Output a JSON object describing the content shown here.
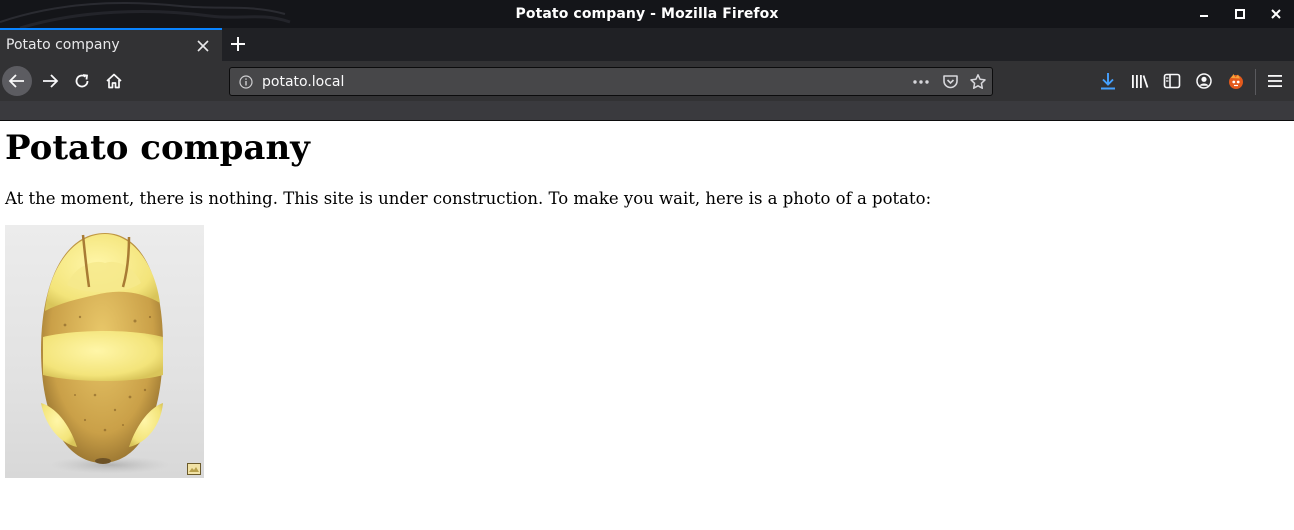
{
  "window": {
    "title": "Potato company - Mozilla Firefox"
  },
  "tabs": [
    {
      "label": "Potato company",
      "active": true
    }
  ],
  "navbar": {
    "url": "potato.local"
  },
  "page": {
    "heading": "Potato company",
    "text": "At the moment, there is nothing. This site is under construction. To make you wait, here is a photo of a potato:"
  },
  "icons": {
    "window_controls": [
      "minimize-icon",
      "maximize-icon",
      "close-icon"
    ],
    "navigation": [
      "back-arrow-icon",
      "forward-arrow-icon",
      "reload-icon",
      "home-icon"
    ],
    "urlbar": [
      "info-icon",
      "page-actions-dots-icon",
      "pocket-icon",
      "bookmark-star-icon"
    ],
    "toolbar": [
      "download-icon",
      "library-icon",
      "sidebar-icon",
      "account-icon",
      "extension-icon",
      "hamburger-menu-icon"
    ]
  },
  "colors": {
    "title_bar": "#141519",
    "tab_strip": "#202125",
    "toolbar": "#323234",
    "tab_accent": "#0a84ff",
    "url_field": "#474749",
    "download_accent": "#45a1ff"
  }
}
